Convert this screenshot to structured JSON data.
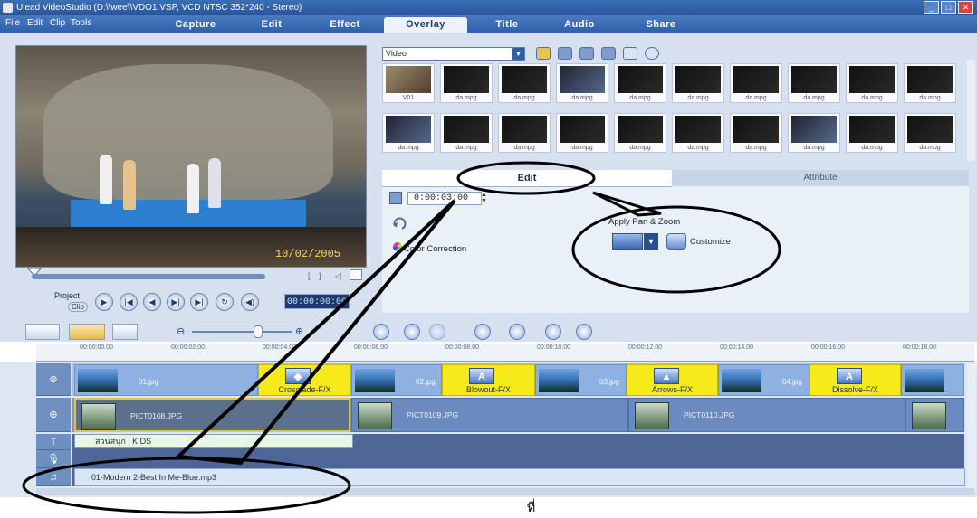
{
  "window": {
    "title": "Ulead VideoStudio (D:\\\\wee\\\\VDO1.VSP, VCD NTSC 352*240 - Stereo)",
    "buttons": [
      "minimize",
      "maximize",
      "close"
    ]
  },
  "menu": [
    "File",
    "Edit",
    "Clip",
    "Tools"
  ],
  "steps": [
    "Capture",
    "Edit",
    "Effect",
    "Overlay",
    "Title",
    "Audio",
    "Share"
  ],
  "active_step": "Overlay",
  "preview": {
    "timestamp": "10/02/2005",
    "project_label": "Project",
    "clip_label": "Clip",
    "timecode": "00:00:00:00"
  },
  "library": {
    "category": "Video",
    "thumbnails": [
      "V01",
      "da.mpg",
      "da.mpg",
      "da.mpg",
      "da.mpg",
      "da.mpg",
      "da.mpg",
      "da.mpg",
      "da.mpg",
      "da.mpg",
      "da.mpg",
      "da.mpg",
      "da.mpg",
      "da.mpg",
      "da.mpg",
      "da.mpg",
      "da.mpg",
      "da.mpg",
      "da.mpg",
      "da.mpg"
    ]
  },
  "options": {
    "tab_edit": "Edit",
    "tab_attribute": "Attribute",
    "duration": "0:00:03:00",
    "color_correction": "Color Correction",
    "apply_pan_zoom": "Apply Pan & Zoom",
    "customize": "Customize"
  },
  "timeline": {
    "ruler": [
      "00:00:00.00",
      "00:00:02.00",
      "00:00:04.00",
      "00:00:06.00",
      "00:00:08.00",
      "00:00:10.00",
      "00:00:12.00",
      "00:00:14.00",
      "00:00:16.00",
      "00:00:18.00"
    ],
    "video_clips": [
      "01.jpg",
      "02.jpg",
      "03.jpg",
      "04.jpg"
    ],
    "transitions": [
      "Crossfade-F/X",
      "Blowout-F/X",
      "Arrows-F/X",
      "Dissolve-F/X"
    ],
    "overlay_clips": [
      "PICT0108.JPG",
      "PICT0109.JPG",
      "PICT0110.JPG"
    ],
    "title_clip": "สวนสนุก | KIDS",
    "music_clip": "01-Modern 2-Best In Me-Blue.mp3"
  },
  "footer_char": "ที่"
}
